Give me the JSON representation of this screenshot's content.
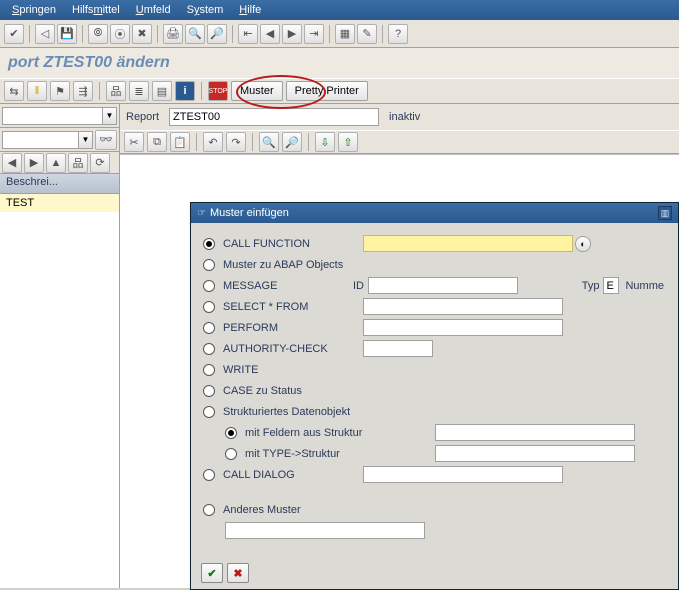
{
  "menu": {
    "items": [
      "Springen",
      "Hilfsmittel",
      "Umfeld",
      "System",
      "Hilfe"
    ]
  },
  "page_title": "port ZTEST00 ändern",
  "app_toolbar": {
    "muster_label": "Muster",
    "pretty_label": "Pretty Printer"
  },
  "report": {
    "label": "Report",
    "value": "ZTEST00",
    "status": "inaktiv"
  },
  "tree": {
    "header": "Beschrei...",
    "row": "TEST"
  },
  "dialog": {
    "title": "Muster einfügen",
    "options": {
      "call_function": "CALL FUNCTION",
      "abap_objects": "Muster zu ABAP Objects",
      "message": "MESSAGE",
      "message_id_label": "ID",
      "message_typ_label": "Typ",
      "message_typ_value": "E",
      "message_num_label": "Numme",
      "select_from": "SELECT * FROM",
      "perform": "PERFORM",
      "authority": "AUTHORITY-CHECK",
      "write": "WRITE",
      "case_status": "CASE zu Status",
      "struct_obj": "Strukturiertes Datenobjekt",
      "struct_fields": "mit Feldern aus Struktur",
      "struct_type": "mit TYPE->Struktur",
      "call_dialog": "CALL DIALOG",
      "other": "Anderes Muster"
    },
    "values": {
      "call_function": "",
      "message_id": "",
      "message_num": "",
      "select_from": "",
      "perform": "",
      "authority": "",
      "struct_fields": "",
      "struct_type": "",
      "call_dialog": "",
      "other": ""
    }
  }
}
